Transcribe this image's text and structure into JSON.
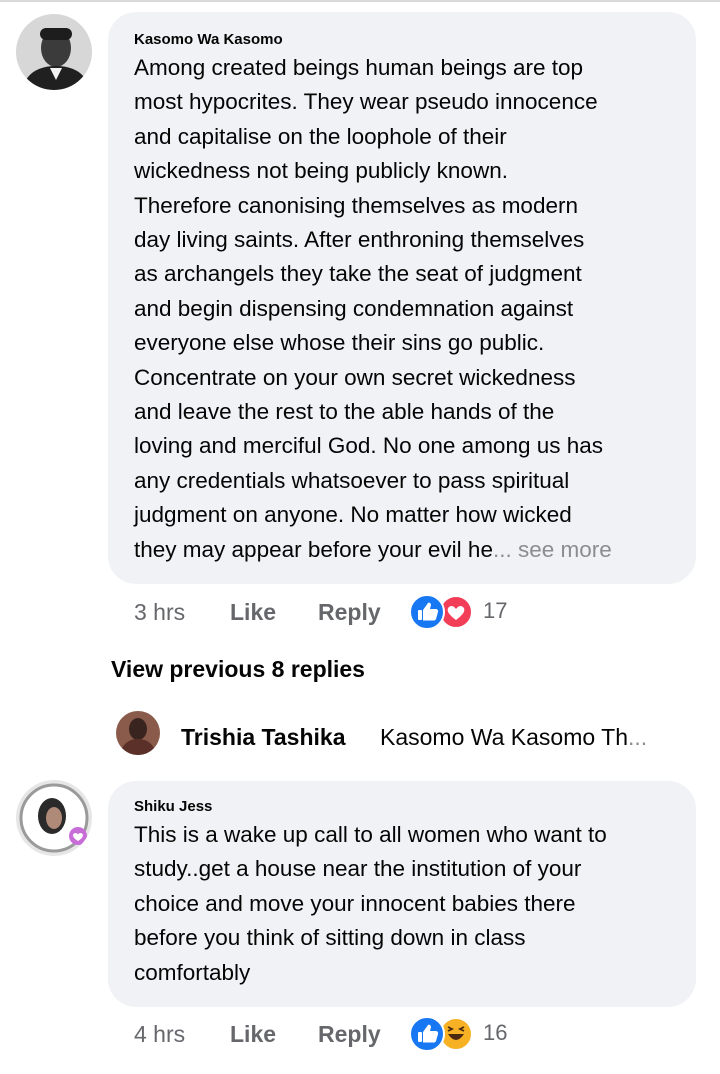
{
  "comments": [
    {
      "author": "Kasomo Wa Kasomo",
      "lines": [
        "Among created beings human beings are top",
        "most hypocrites. They wear pseudo innocence",
        "and capitalise on the loophole of their",
        "wickedness not being publicly known.",
        "Therefore canonising themselves as modern",
        "day living saints. After enthroning themselves",
        "as archangels they take the seat of judgment",
        "and begin dispensing condemnation against",
        "everyone else whose their sins go public.",
        "Concentrate on your own secret wickedness",
        "and leave the rest to the able hands of the",
        "loving and merciful God. No one among us has",
        "any credentials whatsoever to pass spiritual",
        "judgment on anyone. No matter how wicked",
        "they may appear before your evil he"
      ],
      "see_more": "... see more",
      "time": "3 hrs",
      "like_label": "Like",
      "reply_label": "Reply",
      "reaction_icons": [
        "like-icon",
        "love-icon"
      ],
      "reaction_count": "17"
    },
    {
      "author": "Shiku Jess",
      "lines": [
        "This is a wake up call to all women who want to",
        "study..get a house near the institution of your",
        "choice and move your innocent babies there",
        "before you think of sitting down in class",
        "comfortably"
      ],
      "time": "4 hrs",
      "like_label": "Like",
      "reply_label": "Reply",
      "reaction_icons": [
        "like-icon",
        "haha-icon"
      ],
      "reaction_count": "16"
    }
  ],
  "view_previous": "View previous 8 replies",
  "reply_preview": {
    "name": "Trishia Tashika",
    "text": "Kasomo Wa Kasomo Th",
    "ellipsis": "..."
  },
  "colors": {
    "bubble": "#f0f2f5",
    "meta": "#65676b",
    "like_blue": "#1877f2",
    "love_red": "#f33e58",
    "haha_yellow": "#f7b125"
  }
}
